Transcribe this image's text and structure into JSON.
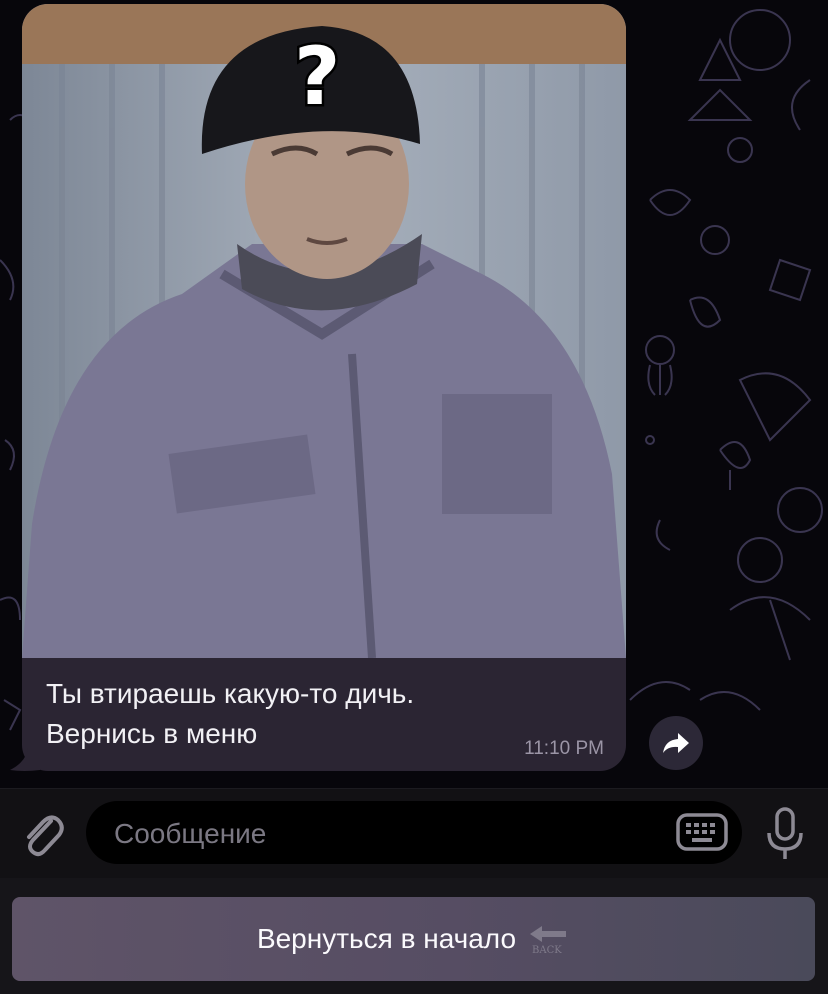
{
  "message": {
    "line1": "Ты втираешь какую-то дичь.",
    "line2": "Вернись в меню",
    "time": "11:10 PM",
    "image_sticker": "?"
  },
  "composer": {
    "placeholder": "Сообщение"
  },
  "reply_keyboard": {
    "button_label": "Вернуться в начало",
    "button_icon_text": "BACK"
  },
  "icons": {
    "share": "share-arrow-icon",
    "attach": "paperclip-icon",
    "keyboard": "keyboard-icon",
    "mic": "microphone-icon",
    "back": "back-arrow-icon"
  },
  "colors": {
    "chat_background": "#07060b",
    "bubble": "#2b2533",
    "composer": "#121114",
    "button_gradient_start": "#5f5468",
    "button_gradient_end": "#4a4a5a"
  }
}
